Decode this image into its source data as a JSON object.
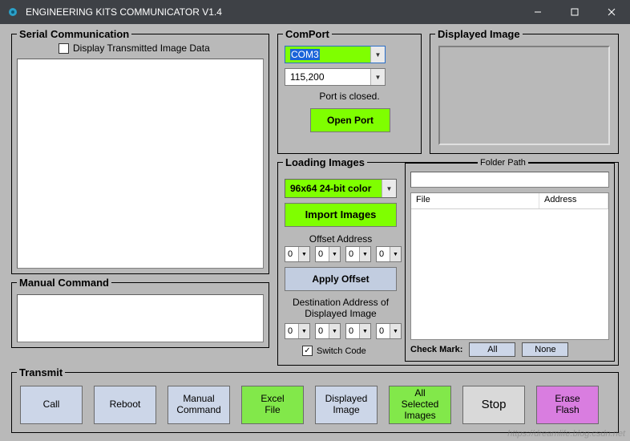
{
  "window": {
    "title": "ENGINEERING KITS COMMUNICATOR V1.4"
  },
  "serial": {
    "group_title": "Serial Communication",
    "checkbox_label": "Display Transmitted Image Data",
    "checkbox_checked": false
  },
  "manual": {
    "group_title": "Manual Command"
  },
  "comport": {
    "group_title": "ComPort",
    "port_value": "COM3",
    "baud_value": "115,200",
    "status_text": "Port is closed.",
    "open_btn": "Open Port"
  },
  "displayed_image": {
    "group_title": "Displayed Image"
  },
  "loading": {
    "group_title": "Loading Images",
    "resolution_value": "96x64 24-bit color",
    "import_btn": "Import Images",
    "offset_label": "Offset Address",
    "offset_values": [
      "0",
      "0",
      "0",
      "0"
    ],
    "apply_offset_btn": "Apply Offset",
    "dest_label_l1": "Destination Address of",
    "dest_label_l2": "Displayed Image",
    "dest_values": [
      "0",
      "0",
      "0",
      "0"
    ],
    "switch_code_label": "Switch Code",
    "switch_code_checked": true
  },
  "folder": {
    "group_title": "Folder  Path",
    "col_file": "File",
    "col_address": "Address",
    "checkmark_label": "Check Mark:",
    "all_btn": "All",
    "none_btn": "None"
  },
  "transmit": {
    "group_title": "Transmit",
    "buttons": {
      "call": "Call",
      "reboot": "Reboot",
      "manual_cmd": "Manual\nCommand",
      "excel": "Excel\nFile",
      "displayed": "Displayed\nImage",
      "all_selected": "All\nSelected\nImages",
      "stop": "Stop",
      "erase": "Erase\nFlash"
    }
  },
  "watermark": "https://dreamlife.blog.csdn.net"
}
